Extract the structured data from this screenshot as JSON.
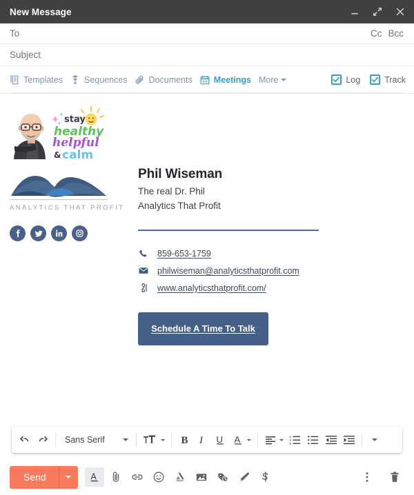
{
  "window": {
    "title": "New Message",
    "controls": [
      {
        "name": "minimize-button",
        "icon": "minimize-icon",
        "label": "Minimize"
      },
      {
        "name": "expand-button",
        "icon": "expand-icon",
        "label": "Full screen"
      },
      {
        "name": "close-button",
        "icon": "close-icon",
        "label": "Save & close"
      }
    ]
  },
  "fields": {
    "to": {
      "label": "To",
      "value": "",
      "placeholder": "To"
    },
    "cc": "Cc",
    "bcc": "Bcc",
    "subject": {
      "label": "Subject",
      "value": "",
      "placeholder": "Subject"
    }
  },
  "hubspot_bar": {
    "items": [
      {
        "label": "Templates",
        "icon": "templates-icon",
        "active": false
      },
      {
        "label": "Sequences",
        "icon": "sequences-icon",
        "active": false
      },
      {
        "label": "Documents",
        "icon": "paperclip-icon",
        "active": false
      },
      {
        "label": "Meetings",
        "icon": "calendar-icon",
        "active": true
      }
    ],
    "more_label": "More",
    "log": {
      "label": "Log",
      "checked": true
    },
    "track": {
      "label": "Track",
      "checked": true
    },
    "accent": "#33a1c9",
    "muted": "#7c98b6"
  },
  "signature": {
    "bitmoji": {
      "alt": "bitmoji-avatar",
      "line1": "stay",
      "line2": "healthy",
      "line3": "helpful",
      "line4": "& calm"
    },
    "logo": {
      "alt": "analytics-that-profit-logo",
      "wordmark": "ANALYTICS THAT PROFIT"
    },
    "socials": [
      {
        "name": "facebook",
        "glyph": "f"
      },
      {
        "name": "twitter",
        "glyph": "t"
      },
      {
        "name": "linkedin",
        "glyph": "in"
      },
      {
        "name": "instagram",
        "glyph": "ig"
      }
    ],
    "name": "Phil Wiseman",
    "tagline": "The real Dr. Phil",
    "company": "Analytics That Profit",
    "contacts": [
      {
        "icon": "phone-icon",
        "text": "859-653-1759"
      },
      {
        "icon": "envelope-icon",
        "text": "philwiseman@analyticsthatprofit.com"
      },
      {
        "icon": "link-icon",
        "text": "www.analyticsthatprofit.com/"
      }
    ],
    "cta": {
      "label": "Schedule A Time To Talk",
      "color": "#456087"
    }
  },
  "format_toolbar": {
    "undo": "Undo",
    "redo": "Redo",
    "font": {
      "selected": "Sans Serif",
      "label": "Font"
    },
    "size_label": "Size",
    "bold": "B",
    "italic": "I",
    "underline": "U",
    "text_color": "A",
    "align_label": "Align",
    "numbered_list": "Numbered list",
    "bulleted_list": "Bulleted list",
    "outdent": "Outdent",
    "indent": "Indent",
    "more": "More formatting options"
  },
  "send_bar": {
    "send_label": "Send",
    "send_color": "#fa7a5d",
    "send_options_label": "More send options",
    "icons": [
      {
        "name": "format-icon",
        "label": "Formatting options",
        "active": true
      },
      {
        "name": "attach-icon",
        "label": "Attach files",
        "active": false
      },
      {
        "name": "link-icon",
        "label": "Insert link",
        "active": false
      },
      {
        "name": "emoji-icon",
        "label": "Insert emoji",
        "active": false
      },
      {
        "name": "drive-icon",
        "label": "Insert files using Drive",
        "active": false
      },
      {
        "name": "image-icon",
        "label": "Insert photo",
        "active": false
      },
      {
        "name": "confidential-icon",
        "label": "Toggle confidential mode",
        "active": false
      },
      {
        "name": "signature-icon",
        "label": "Insert signature",
        "active": false
      },
      {
        "name": "money-icon",
        "label": "Send money",
        "active": false
      }
    ],
    "more_options_label": "More options",
    "discard_label": "Discard draft"
  }
}
